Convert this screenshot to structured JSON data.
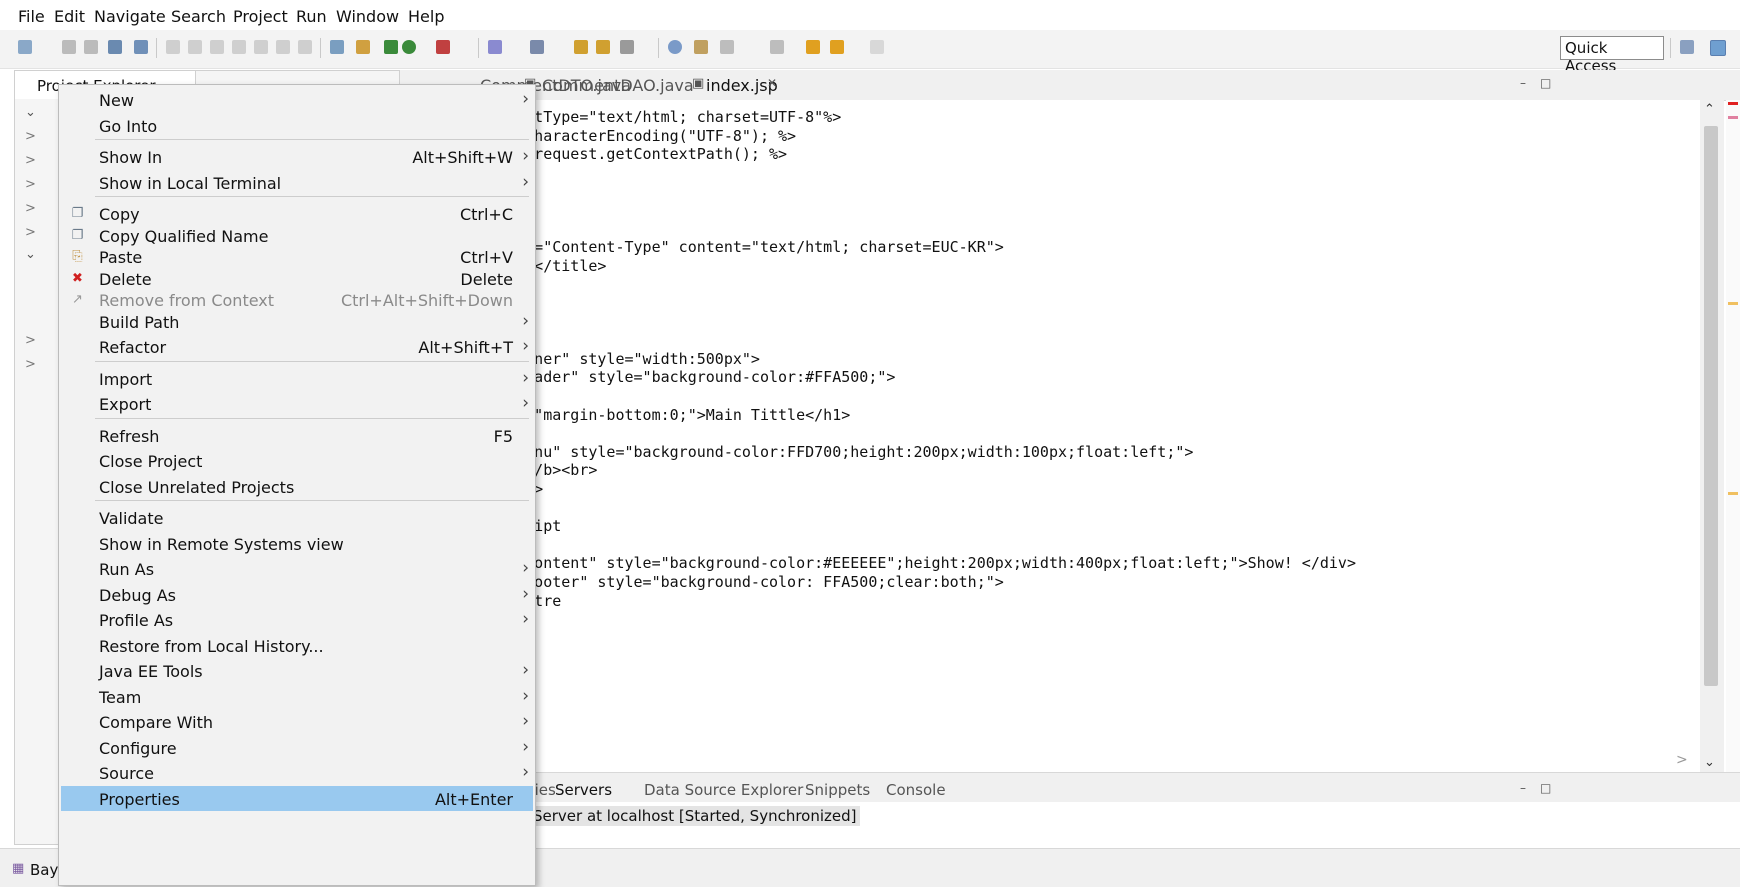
{
  "menubar": [
    "File",
    "Edit",
    "Navigate",
    "Search",
    "Project",
    "Run",
    "Window",
    "Help"
  ],
  "toolbar": {
    "quick_access": "Quick Access"
  },
  "explorer": {
    "tab_label": "Project Explorer",
    "status_project": "Bay"
  },
  "editor": {
    "tabs": [
      "CommentDTO.java",
      "CommentDAO.java",
      "index.jsp"
    ],
    "lines": [
      "contentType=\"text/html; charset=UTF-8\"%>",
      "t.setCharacterEncoding(\"UTF-8\"); %>",
      " cp = request.getContextPath(); %>",
      " html>",
      "",
      "",
      "",
      "-equiv=\"Content-Type\" content=\"text/html; charset=EUC-KR\">",
      "fe Bay</title>",
      "",
      "",
      "",
      "",
      "container\" style=\"width:500px\">",
      "id=\"header\" style=\"background-color:#FFA500;\">",
      "",
      "tyle =\"margin-bottom:0;\">Main Tittle</h1>",
      ">",
      "id=\"menu\" style=\"background-color:FFD700;height:200px;width:100px;float:left;\">",
      ">Menu</b><br>",
      "TML<br>",
      "SS<br>",
      "avaScript",
      ">",
      "id =\"content\" style=\"background-color:#EEEEEE\";height:200px;width:400px;float:left;\">Show! </div>",
      "id =\"footer\" style=\"background-color: FFA500;clear:both;\">",
      "IT Centre",
      ">"
    ]
  },
  "bottom": {
    "tabs": [
      "Properties",
      "Servers",
      "Data Source Explorer",
      "Snippets",
      "Console"
    ],
    "server_row": "Server at localhost  [Started, Synchronized]"
  },
  "context_menu": [
    {
      "label": "New",
      "accel": "",
      "submenu": true
    },
    {
      "label": "Go Into",
      "accel": "",
      "submenu": false
    },
    {
      "label": "Show In",
      "accel": "Alt+Shift+W",
      "submenu": true
    },
    {
      "label": "Show in Local Terminal",
      "accel": "",
      "submenu": true
    },
    {
      "label": "Copy",
      "accel": "Ctrl+C",
      "submenu": false,
      "icon": "copy-icon"
    },
    {
      "label": "Copy Qualified Name",
      "accel": "",
      "submenu": false,
      "icon": "copy-qualified-icon"
    },
    {
      "label": "Paste",
      "accel": "Ctrl+V",
      "submenu": false,
      "icon": "paste-icon"
    },
    {
      "label": "Delete",
      "accel": "Delete",
      "submenu": false,
      "icon": "delete-icon"
    },
    {
      "label": "Remove from Context",
      "accel": "Ctrl+Alt+Shift+Down",
      "submenu": false,
      "disabled": true,
      "icon": "remove-context-icon"
    },
    {
      "label": "Build Path",
      "accel": "",
      "submenu": true
    },
    {
      "label": "Refactor",
      "accel": "Alt+Shift+T",
      "submenu": true
    },
    {
      "label": "Import",
      "accel": "",
      "submenu": true
    },
    {
      "label": "Export",
      "accel": "",
      "submenu": true
    },
    {
      "label": "Refresh",
      "accel": "F5",
      "submenu": false
    },
    {
      "label": "Close Project",
      "accel": "",
      "submenu": false
    },
    {
      "label": "Close Unrelated Projects",
      "accel": "",
      "submenu": false
    },
    {
      "label": "Validate",
      "accel": "",
      "submenu": false
    },
    {
      "label": "Show in Remote Systems view",
      "accel": "",
      "submenu": false
    },
    {
      "label": "Run As",
      "accel": "",
      "submenu": true
    },
    {
      "label": "Debug As",
      "accel": "",
      "submenu": true
    },
    {
      "label": "Profile As",
      "accel": "",
      "submenu": true
    },
    {
      "label": "Restore from Local History...",
      "accel": "",
      "submenu": false
    },
    {
      "label": "Java EE Tools",
      "accel": "",
      "submenu": true
    },
    {
      "label": "Team",
      "accel": "",
      "submenu": true
    },
    {
      "label": "Compare With",
      "accel": "",
      "submenu": true
    },
    {
      "label": "Configure",
      "accel": "",
      "submenu": true
    },
    {
      "label": "Source",
      "accel": "",
      "submenu": true
    },
    {
      "label": "Properties",
      "accel": "Alt+Enter",
      "submenu": false,
      "highlighted": true
    }
  ]
}
